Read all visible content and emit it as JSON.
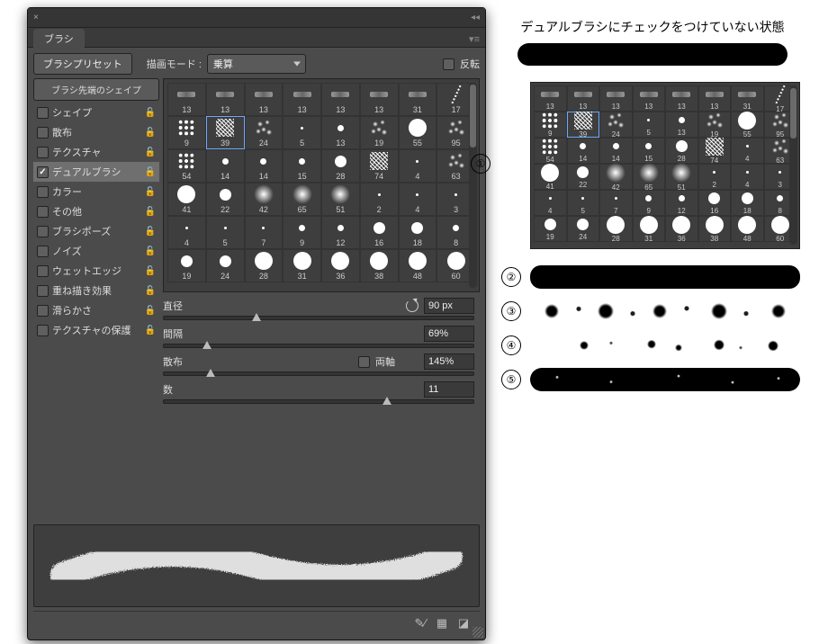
{
  "panel": {
    "title": "ブラシ",
    "preset_button": "ブラシプリセット",
    "mode_label": "描画モード :",
    "mode_value": "乗算",
    "flip_label": "反転",
    "tip_shape_button": "ブラシ先端のシェイプ"
  },
  "options": [
    {
      "label": "シェイプ",
      "checked": false,
      "locked": true,
      "selected": false
    },
    {
      "label": "散布",
      "checked": false,
      "locked": true,
      "selected": false
    },
    {
      "label": "テクスチャ",
      "checked": false,
      "locked": true,
      "selected": false
    },
    {
      "label": "デュアルブラシ",
      "checked": true,
      "locked": true,
      "selected": true
    },
    {
      "label": "カラー",
      "checked": false,
      "locked": true,
      "selected": false
    },
    {
      "label": "その他",
      "checked": false,
      "locked": true,
      "selected": false
    },
    {
      "label": "ブラシポーズ",
      "checked": false,
      "locked": true,
      "selected": false
    },
    {
      "label": "ノイズ",
      "checked": false,
      "locked": true,
      "selected": false
    },
    {
      "label": "ウェットエッジ",
      "checked": false,
      "locked": true,
      "selected": false
    },
    {
      "label": "重ね描き効果",
      "checked": false,
      "locked": true,
      "selected": false
    },
    {
      "label": "滑らかさ",
      "checked": false,
      "locked": true,
      "selected": false
    },
    {
      "label": "テクスチャの保護",
      "checked": false,
      "locked": true,
      "selected": false
    }
  ],
  "brushes": [
    {
      "size": "13",
      "ico": "dash"
    },
    {
      "size": "13",
      "ico": "dash"
    },
    {
      "size": "13",
      "ico": "dash"
    },
    {
      "size": "13",
      "ico": "dash"
    },
    {
      "size": "13",
      "ico": "dash"
    },
    {
      "size": "13",
      "ico": "dash"
    },
    {
      "size": "31",
      "ico": "dash"
    },
    {
      "size": "17",
      "ico": "diag"
    },
    {
      "size": "9",
      "ico": "dots9"
    },
    {
      "size": "39",
      "ico": "scratchy",
      "selected": true
    },
    {
      "size": "24",
      "ico": "spray"
    },
    {
      "size": "5",
      "ico": "dot-s"
    },
    {
      "size": "13",
      "ico": "dot-m"
    },
    {
      "size": "19",
      "ico": "spray"
    },
    {
      "size": "55",
      "ico": "dot-xl"
    },
    {
      "size": "95",
      "ico": "spray"
    },
    {
      "size": "54",
      "ico": "dots9"
    },
    {
      "size": "14",
      "ico": "dot-m"
    },
    {
      "size": "14",
      "ico": "dot-m"
    },
    {
      "size": "15",
      "ico": "dot-m"
    },
    {
      "size": "28",
      "ico": "dot-l"
    },
    {
      "size": "74",
      "ico": "scratchy"
    },
    {
      "size": "4",
      "ico": "dot-s"
    },
    {
      "size": "63",
      "ico": "spray"
    },
    {
      "size": "41",
      "ico": "dot-xl"
    },
    {
      "size": "22",
      "ico": "dot-l"
    },
    {
      "size": "42",
      "ico": "blur-l"
    },
    {
      "size": "65",
      "ico": "blur-l"
    },
    {
      "size": "51",
      "ico": "blur-l"
    },
    {
      "size": "2",
      "ico": "dot-s"
    },
    {
      "size": "4",
      "ico": "dot-s"
    },
    {
      "size": "3",
      "ico": "dot-s"
    },
    {
      "size": "4",
      "ico": "dot-s"
    },
    {
      "size": "5",
      "ico": "dot-s"
    },
    {
      "size": "7",
      "ico": "dot-s"
    },
    {
      "size": "9",
      "ico": "dot-m"
    },
    {
      "size": "12",
      "ico": "dot-m"
    },
    {
      "size": "16",
      "ico": "dot-l"
    },
    {
      "size": "18",
      "ico": "dot-l"
    },
    {
      "size": "8",
      "ico": "dot-m"
    },
    {
      "size": "19",
      "ico": "dot-l"
    },
    {
      "size": "24",
      "ico": "dot-l"
    },
    {
      "size": "28",
      "ico": "dot-xl"
    },
    {
      "size": "31",
      "ico": "dot-xl"
    },
    {
      "size": "36",
      "ico": "dot-xl"
    },
    {
      "size": "38",
      "ico": "dot-xl"
    },
    {
      "size": "48",
      "ico": "dot-xl"
    },
    {
      "size": "60",
      "ico": "dot-xl"
    }
  ],
  "sliders": {
    "diameter": {
      "label": "直径",
      "value": "90 px",
      "percent": 30,
      "reset": true
    },
    "spacing": {
      "label": "間隔",
      "value": "69%",
      "percent": 14
    },
    "scatter": {
      "label": "散布",
      "value": "145%",
      "percent": 15,
      "both_axes_label": "両軸",
      "both_axes": false
    },
    "count": {
      "label": "数",
      "value": "11",
      "percent": 72
    }
  },
  "demo": {
    "title": "デュアルブラシにチェックをつけていない状態",
    "rows": [
      "①",
      "②",
      "③",
      "④",
      "⑤"
    ]
  }
}
